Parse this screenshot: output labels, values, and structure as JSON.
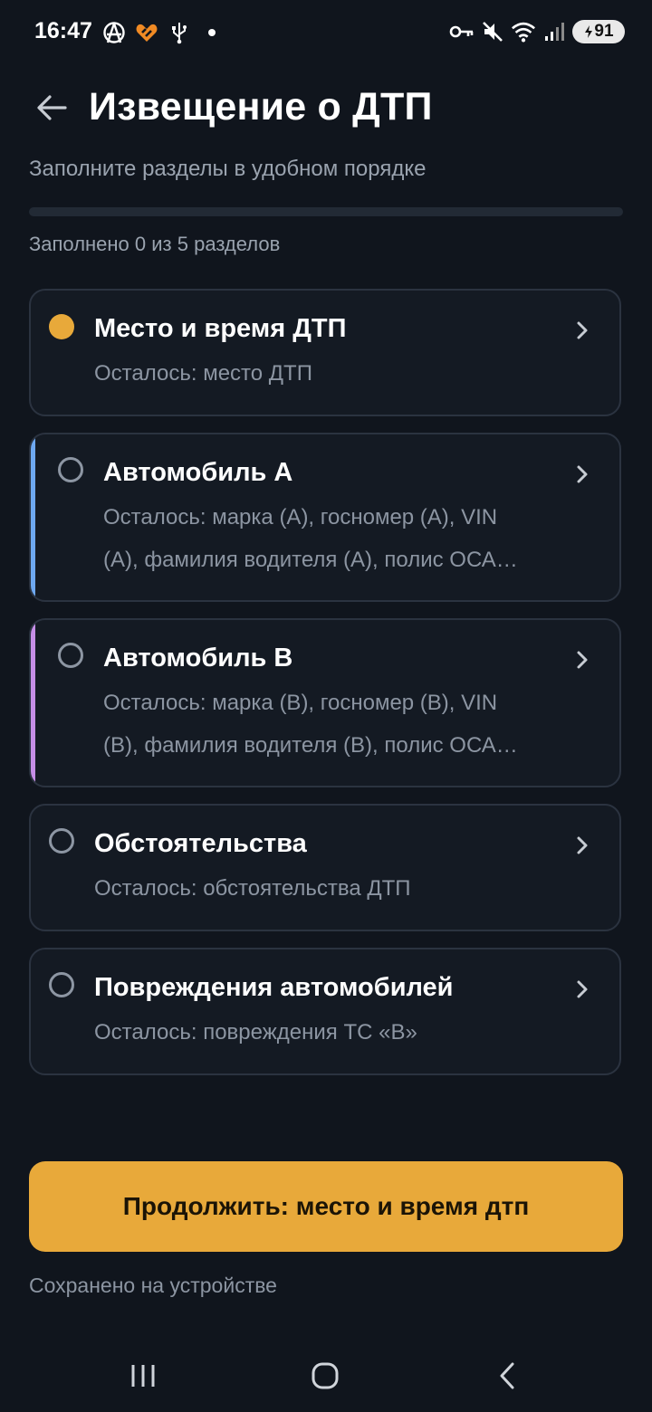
{
  "status_bar": {
    "time": "16:47",
    "left_icons": [
      "anarchy-icon",
      "app-heart-icon",
      "usb-icon",
      "dot-icon"
    ],
    "right_icons": [
      "key-icon",
      "mute-icon",
      "wifi-icon",
      "signal-icon"
    ],
    "battery": "91"
  },
  "header": {
    "title": "Извещение о ДТП",
    "subtitle": "Заполните разделы в удобном порядке",
    "progress_value": 0,
    "progress_text": "Заполнено 0 из 5 разделов"
  },
  "sections": [
    {
      "title": "Место и время ДТП",
      "remaining": "Осталось: место ДТП",
      "status": "current",
      "accent": null
    },
    {
      "title": "Автомобиль А",
      "remaining_line1": "Осталось: марка (А), госномер (А), VIN",
      "remaining_line2": "(А), фамилия водителя (А), полис ОСА…",
      "status": "empty",
      "accent": "#6ea8f0"
    },
    {
      "title": "Автомобиль В",
      "remaining_line1": "Осталось: марка (В), госномер (В), VIN",
      "remaining_line2": "(В), фамилия водителя (В), полис ОСА…",
      "status": "empty",
      "accent": "#c58ee6"
    },
    {
      "title": "Обстоятельства",
      "remaining": "Осталось: обстоятельства ДТП",
      "status": "empty",
      "accent": null
    },
    {
      "title": "Повреждения автомобилей",
      "remaining": "Осталось: повреждения ТС «В»",
      "status": "empty",
      "accent": null
    }
  ],
  "continue_button": {
    "label": "Продолжить: место и время дтп"
  },
  "saved_note": "Сохранено на устройстве",
  "colors": {
    "accent": "#e8a93a",
    "background": "#10151d",
    "card": "#141a23",
    "car_a": "#6ea8f0",
    "car_b": "#c58ee6"
  },
  "nav": {
    "buttons": [
      "recents-icon",
      "home-icon",
      "back-icon"
    ]
  }
}
